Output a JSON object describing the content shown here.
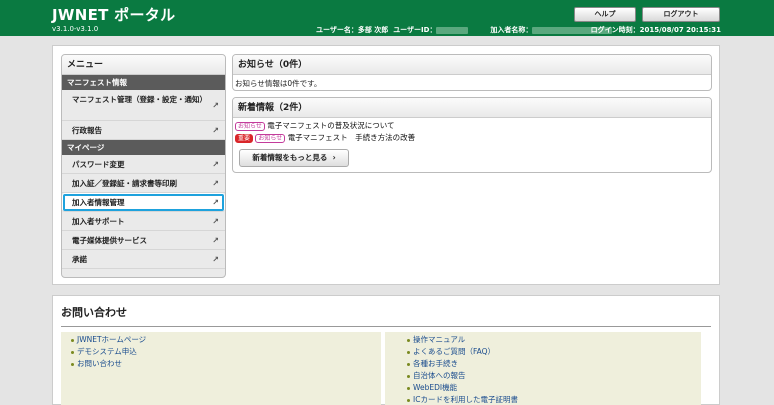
{
  "header": {
    "title": "JWNET ポータル",
    "version": "v3.1.0-v3.1.0",
    "user_name_label": "ユーザー名：",
    "user_name": "多部 次郎",
    "user_id_label": "ユーザーID：",
    "member_name_label": "加入者名称：",
    "login_time_label": "ログイン時刻：",
    "login_time": "2015/08/07 20:15:31",
    "help_label": "ヘルプ",
    "logout_label": "ログアウト"
  },
  "menu": {
    "title": "メニュー",
    "sections": [
      {
        "label": "マニフェスト情報",
        "items": [
          {
            "label": "マニフェスト管理（登録・設定・通知）"
          },
          {
            "label": "行政報告"
          }
        ]
      },
      {
        "label": "マイページ",
        "items": [
          {
            "label": "パスワード変更"
          },
          {
            "label": "加入証／登録証・請求書等印刷"
          },
          {
            "label": "加入者情報管理"
          },
          {
            "label": "加入者サポート"
          },
          {
            "label": "電子媒体提供サービス"
          },
          {
            "label": "承諾"
          }
        ]
      }
    ]
  },
  "notice": {
    "title": "お知らせ（0件）",
    "text": "お知らせ情報は0件です。"
  },
  "news": {
    "title": "新着情報（2件）",
    "tag_notice": "お知らせ",
    "tag_important": "重要",
    "items": [
      {
        "text": "電子マニフェストの普及状況について"
      },
      {
        "text": "電子マニフェスト　手続き方法の改善"
      }
    ],
    "more_label": "新着情報をもっと見る"
  },
  "contact": {
    "title": "お問い合わせ",
    "left_links": [
      "JWNETホームページ",
      "デモシステム申込",
      "お問い合わせ"
    ],
    "right_links": [
      "操作マニュアル",
      "よくあるご質問（FAQ）",
      "各種お手続き",
      "自治体への報告",
      "WebEDI機能",
      "ICカードを利用した電子証明書"
    ]
  },
  "colors": {
    "header_bg": "#0a7a41",
    "selected_outline": "#1ea2dd",
    "tag_important": "#d9262a",
    "tag_notice": "#c33c9b"
  }
}
